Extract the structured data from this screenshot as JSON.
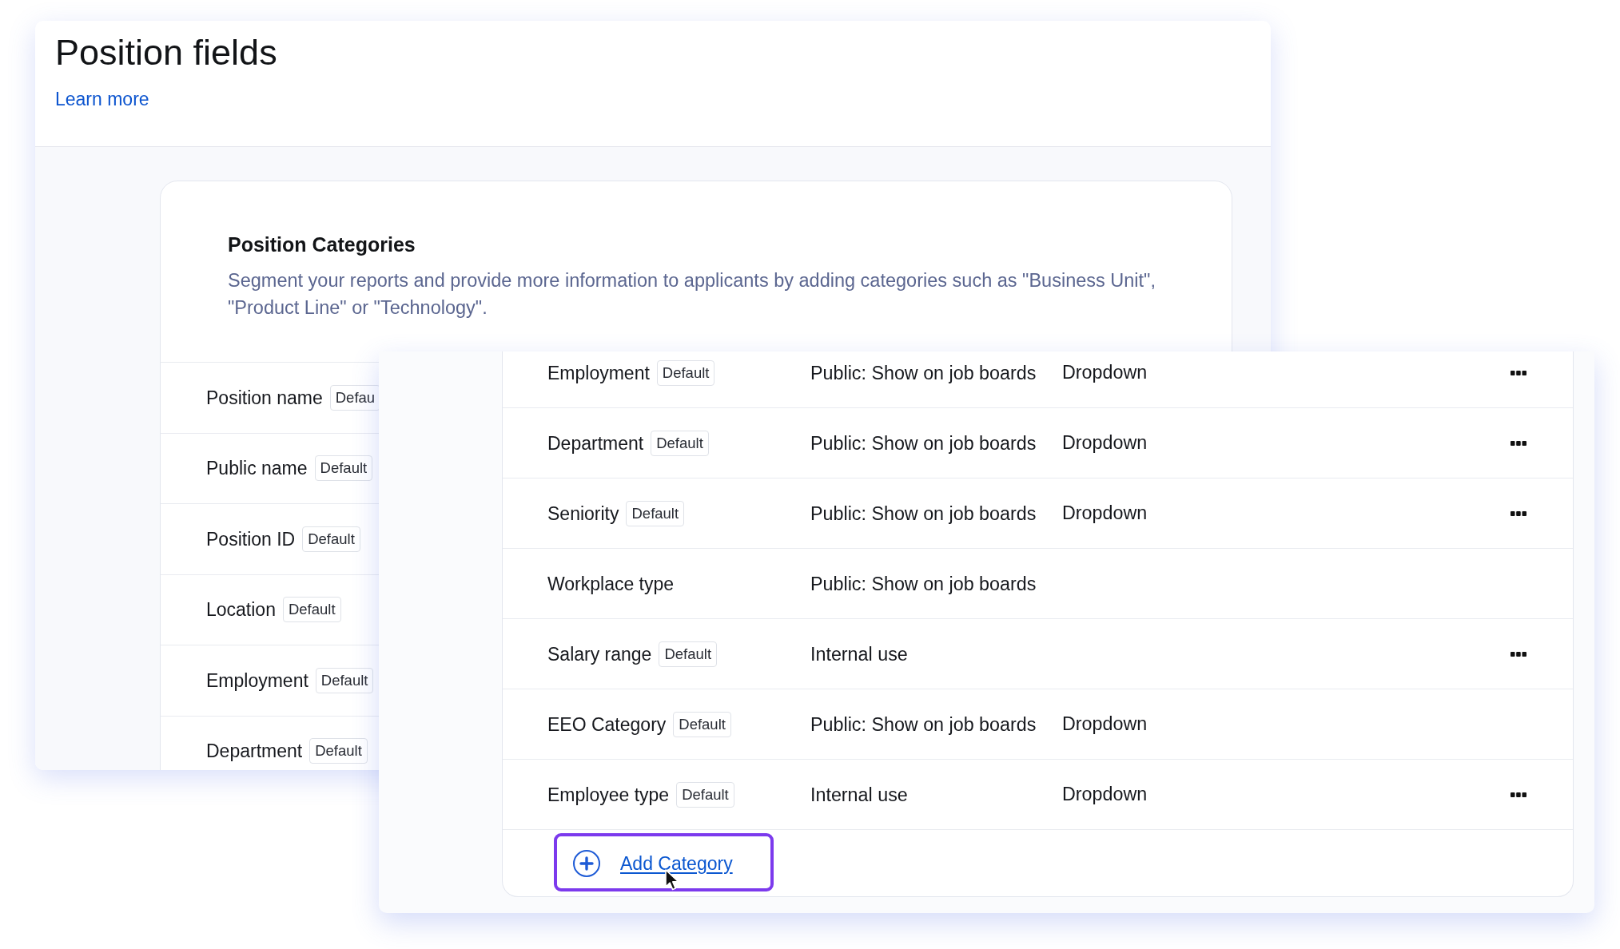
{
  "page": {
    "title": "Position fields",
    "learn_more_link": "Learn more"
  },
  "categories_card": {
    "heading": "Position Categories",
    "description": "Segment your reports and provide more information to applicants by adding categories such as \"Business Unit\", \"Product Line\" or \"Technology\".",
    "rows": [
      {
        "name": "Position name",
        "badge": "Defau"
      },
      {
        "name": "Public name",
        "badge": "Default"
      },
      {
        "name": "Position ID",
        "badge": "Default"
      },
      {
        "name": "Location",
        "badge": "Default"
      },
      {
        "name": "Employment",
        "badge": "Default"
      },
      {
        "name": "Department",
        "badge": "Default"
      }
    ]
  },
  "overlay_panel": {
    "rows": [
      {
        "name": "Employment",
        "badge": "Default",
        "visibility": "Public: Show on job boards",
        "type": "Dropdown",
        "menu": true
      },
      {
        "name": "Department",
        "badge": "Default",
        "visibility": "Public: Show on job boards",
        "type": "Dropdown",
        "menu": true
      },
      {
        "name": "Seniority",
        "badge": "Default",
        "visibility": "Public: Show on job boards",
        "type": "Dropdown",
        "menu": true
      },
      {
        "name": "Workplace type",
        "visibility": "Public: Show on job boards",
        "menu": false
      },
      {
        "name": "Salary range",
        "badge": "Default",
        "visibility": "Internal use",
        "menu": true
      },
      {
        "name": "EEO Category",
        "badge": "Default",
        "visibility": "Public: Show on job boards",
        "type": "Dropdown",
        "menu": false
      },
      {
        "name": "Employee type",
        "badge": "Default",
        "visibility": "Internal use",
        "type": "Dropdown",
        "menu": true
      }
    ],
    "add_category": {
      "label": "Add Category",
      "highlighted": true,
      "hovered": true
    }
  }
}
